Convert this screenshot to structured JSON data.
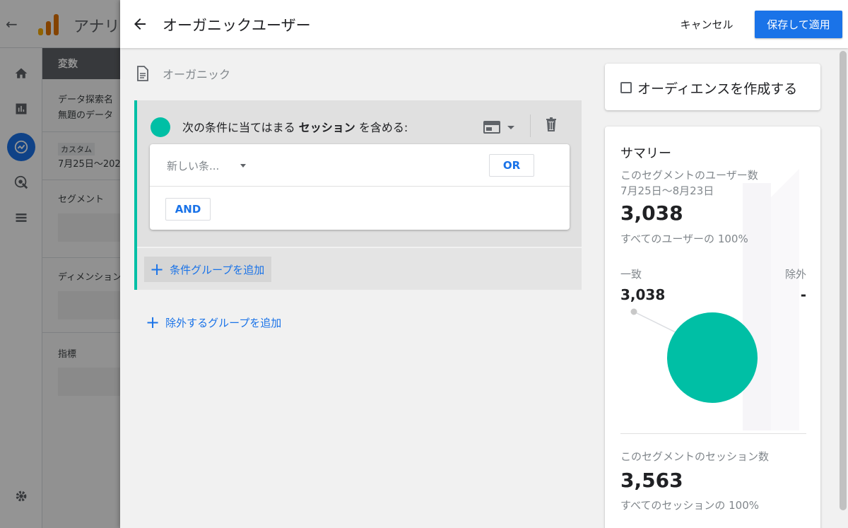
{
  "background_app": {
    "app_name": "アナリ",
    "panel_header": "変数",
    "exploration_label": "データ探索名",
    "exploration_name": "無題のデータ",
    "date_chip": "カスタム",
    "date_range": "7月25日～202",
    "segments_label": "セグメント",
    "dimensions_label": "ディメンション",
    "metrics_label": "指標",
    "logo_colors": [
      "#f9ab00",
      "#e37400",
      "#e37400"
    ]
  },
  "header": {
    "title": "オーガニックユーザー",
    "cancel_label": "キャンセル",
    "save_label": "保存して適用"
  },
  "segment": {
    "name": "オーガニック"
  },
  "condition_group": {
    "label_prefix": "次の条件に当てはまる",
    "label_scope": "セッション",
    "label_suffix": "を含める:",
    "new_condition_placeholder": "新しい条...",
    "or_label": "OR",
    "and_label": "AND",
    "add_group_label": "条件グループを追加",
    "accent_color": "#00bfa5"
  },
  "add_exclude_label": "除外するグループを追加",
  "audience": {
    "label": "オーディエンスを作成する",
    "checked": false
  },
  "summary": {
    "title": "サマリー",
    "users_label": "このセグメントのユーザー数",
    "date_range": "7月25日～8月23日",
    "users_value": "3,038",
    "users_percent_text": "すべてのユーザーの 100%",
    "match_label": "一致",
    "exclude_label": "除外",
    "match_value": "3,038",
    "exclude_value": "-",
    "sessions_label": "このセグメントのセッション数",
    "sessions_value": "3,563",
    "sessions_percent_text": "すべてのセッションの 100%",
    "pie_color": "#00bfa5"
  },
  "chart_data": {
    "type": "pie",
    "categories": [
      "一致",
      "除外"
    ],
    "values": [
      3038,
      0
    ]
  }
}
